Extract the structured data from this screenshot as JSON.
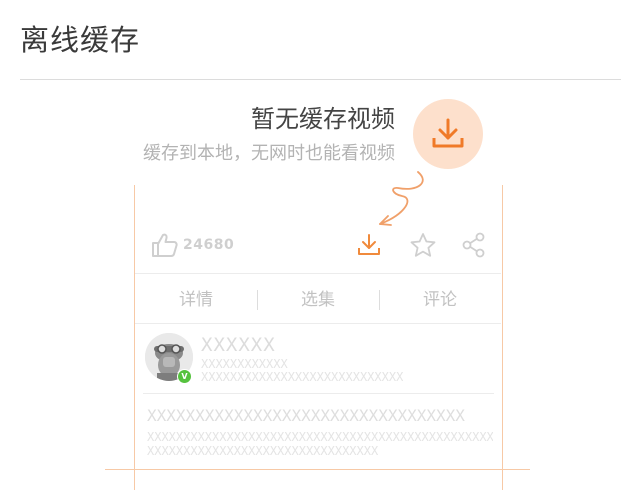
{
  "header": {
    "title": "离线缓存"
  },
  "empty_state": {
    "heading": "暂无缓存视频",
    "subtitle": "缓存到本地，无网时也能看视频",
    "icon": "download-icon"
  },
  "mockup": {
    "like_count": "24680",
    "tabs": [
      "详情",
      "选集",
      "评论"
    ],
    "author_name": "XXXXXX",
    "author_line1": "XXXXXXXXXXXX",
    "author_line2": "XXXXXXXXXXXXXXXXXXXXXXXXXXXX",
    "video_title": "XXXXXXXXXXXXXXXXXXXXXXXXXXXXXXXXX",
    "video_desc1": "XXXXXXXXXXXXXXXXXXXXXXXXXXXXXXXXXXXXXXXXXXXXXXXXX",
    "video_desc2": "XXXXXXXXXXXXXXXXXXXXXXXXXXXXXXXX"
  },
  "colors": {
    "accent": "#f08a3c",
    "accent_light": "#fde0cc",
    "verified": "#56c23f"
  }
}
